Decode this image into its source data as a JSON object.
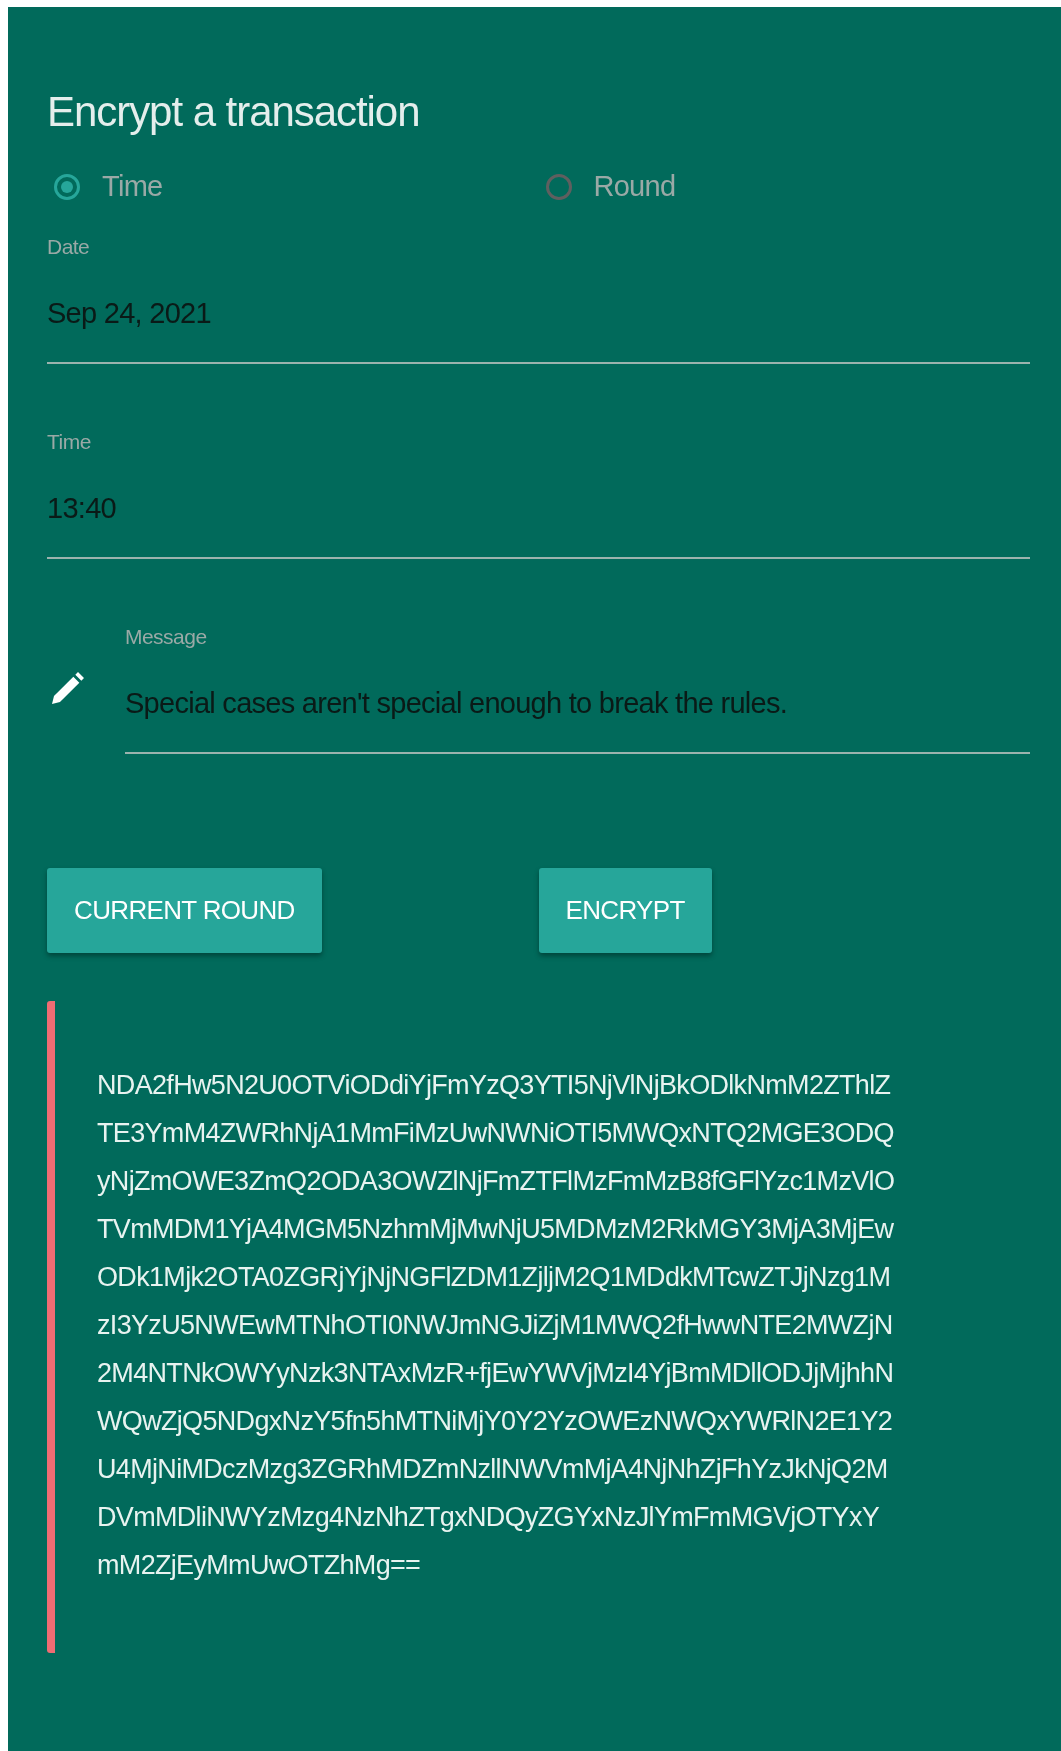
{
  "title": "Encrypt a transaction",
  "mode_options": [
    {
      "label": "Time",
      "selected": true
    },
    {
      "label": "Round",
      "selected": false
    }
  ],
  "fields": [
    {
      "label": "Date",
      "value": "Sep 24, 2021",
      "icon": false
    },
    {
      "label": "Time",
      "value": "13:40",
      "icon": false
    },
    {
      "label": "Message",
      "value": "Special cases aren't special enough to break the rules.",
      "icon": true
    }
  ],
  "buttons": [
    "CURRENT ROUND",
    "ENCRYPT"
  ],
  "ciphertext": "NDA2fHw5N2U0OTViODdiYjFmYzQ3YTI5NjVlNjBkODlkNmM2ZThlZTE3YmM4ZWRhNjA1MmFiMzUwNWNiOTI5MWQxNTQ2MGE3ODQyNjZmOWE3ZmQ2ODA3OWZlNjFmZTFlMzFmMzB8fGFlYzc1MzVlOTVmMDM1YjA4MGM5NzhmMjMwNjU5MDMzM2RkMGY3MjA3MjEwODk1Mjk2OTA0ZGRjYjNjNGFlZDM1ZjljM2Q1MDdkMTcwZTJjNzg1MzI3YzU5NWEwMTNhOTI0NWJmNGJiZjM1MWQ2fHwwNTE2MWZjN2M4NTNkOWYyNzk3NTAxMzR+fjEwYWVjMzI4YjBmMDllODJjMjhhNWQwZjQ5NDgxNzY5fn5hMTNiMjY0Y2YzOWEzNWQxYWRlN2E1Y2U4MjNiMDczMzg3ZGRhMDZmNzllNWVmMjA4NjNhZjFhYzJkNjQ2MDVmMDliNWYzMzg4NzNhZTgxNDQyZGYxNzJlYmFmMGVjOTYxYmM2ZjEyMmUwOTZhMg=="
}
